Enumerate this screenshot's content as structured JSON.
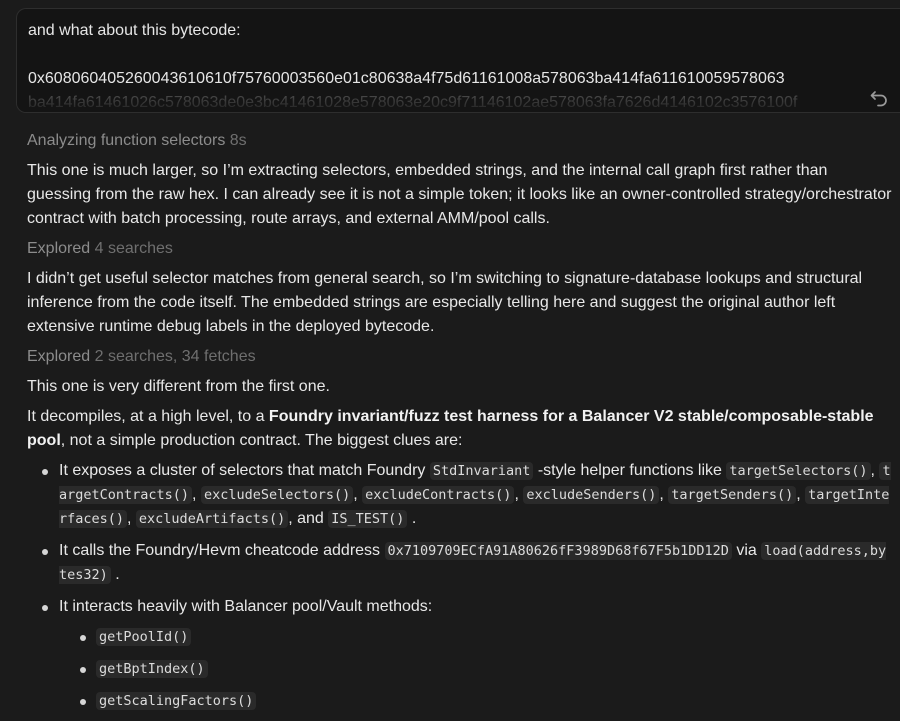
{
  "prompt": {
    "text": "and what about this bytecode:",
    "bytecode_line1": "0x608060405260043610610f75760003560e01c80638a4f75d61161008a578063ba414fa611610059578063",
    "bytecode_line2": "ba414fa61461026c578063de0e3bc41461028e578063e20c9f71146102ae578063fa7626d4146102c3576100f"
  },
  "statuses": {
    "analyzing": {
      "label": "Analyzing function selectors",
      "meta": "8s"
    },
    "explored1": {
      "label": "Explored",
      "meta": "4 searches"
    },
    "explored2": {
      "label": "Explored",
      "meta": "2 searches, 34 fetches"
    }
  },
  "paragraphs": {
    "p1": "This one is much larger, so I’m extracting selectors, embedded strings, and the internal call graph first rather than guessing from the raw hex. I can already see it is not a simple token; it looks like an owner-controlled strategy/orchestrator contract with batch processing, route arrays, and external AMM/pool calls.",
    "p2": "I didn’t get useful selector matches from general search, so I’m switching to signature-database lookups and structural inference from the code itself. The embedded strings are especially telling here and suggest the original author left extensive runtime debug labels in the deployed bytecode.",
    "p3": "This one is very different from the first one.",
    "p4_a": "It decompiles, at a high level, to a ",
    "p4_bold": "Foundry invariant/fuzz test harness for a Balancer V2 stable/composable-stable pool",
    "p4_b": ", not a simple production contract. The biggest clues are:"
  },
  "bullet1": {
    "t1": "It exposes a cluster of selectors that match Foundry ",
    "c_stdinv": "StdInvariant",
    "t2": " -style helper functions like ",
    "c1": "targetSelectors()",
    "c2": "targetContracts()",
    "c3": "excludeSelectors()",
    "c4": "excludeContracts()",
    "c5": "excludeSenders()",
    "c6": "targetSenders()",
    "c7": "targetInterfaces()",
    "c8": "excludeArtifacts()",
    "c9": "IS_TEST()",
    "comma": ", ",
    "and": ", and ",
    "end": " ."
  },
  "bullet2": {
    "t1": "It calls the Foundry/Hevm cheatcode address ",
    "addr": "0x7109709ECfA91A80626fF3989D68f67F5b1DD12D",
    "via": " via ",
    "fn": "load(address,bytes32)",
    "end": " ."
  },
  "bullet3": {
    "t1": "It interacts heavily with Balancer pool/Vault methods:",
    "sub": [
      "getPoolId()",
      "getBptIndex()",
      "getScalingFactors()"
    ]
  }
}
